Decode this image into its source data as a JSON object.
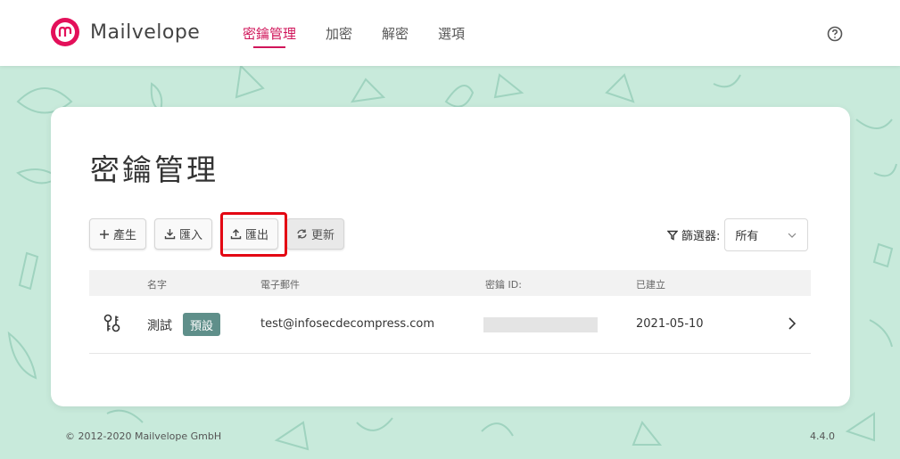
{
  "app": {
    "name": "Mailvelope"
  },
  "nav": {
    "items": [
      {
        "label": "密鑰管理"
      },
      {
        "label": "加密"
      },
      {
        "label": "解密"
      },
      {
        "label": "選項"
      }
    ]
  },
  "page": {
    "title": "密鑰管理"
  },
  "toolbar": {
    "generate_label": "產生",
    "import_label": "匯入",
    "export_label": "匯出",
    "refresh_label": "更新"
  },
  "filter": {
    "label": "篩選器:",
    "selected": "所有"
  },
  "table": {
    "headers": {
      "name": "名字",
      "email": "電子郵件",
      "keyid": "密鑰 ID:",
      "created": "已建立"
    },
    "rows": [
      {
        "name": "測試",
        "badge": "預設",
        "email": "test@infosecdecompress.com",
        "created": "2021-05-10"
      }
    ]
  },
  "footer": {
    "copyright": "© 2012-2020  Mailvelope GmbH",
    "version": "4.4.0"
  },
  "colors": {
    "accent": "#d0155a",
    "background": "#c8eadb",
    "badge": "#5f8f8a",
    "highlight": "#e30613"
  }
}
